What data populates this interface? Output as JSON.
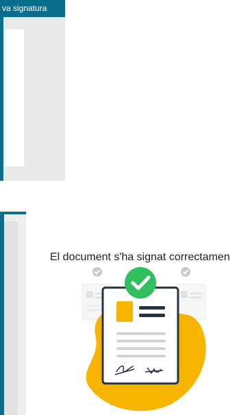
{
  "dialog": {
    "title_fragment": "va signatura"
  },
  "success": {
    "message": "El document s'ha signat correctamen"
  },
  "colors": {
    "titlebar": "#0a6f8d",
    "accent_yellow": "#f7b500",
    "success_green": "#2fbf5d",
    "document_border": "#273248"
  },
  "icons": {
    "check": "check-circle-icon",
    "signature": "signature-icon"
  }
}
